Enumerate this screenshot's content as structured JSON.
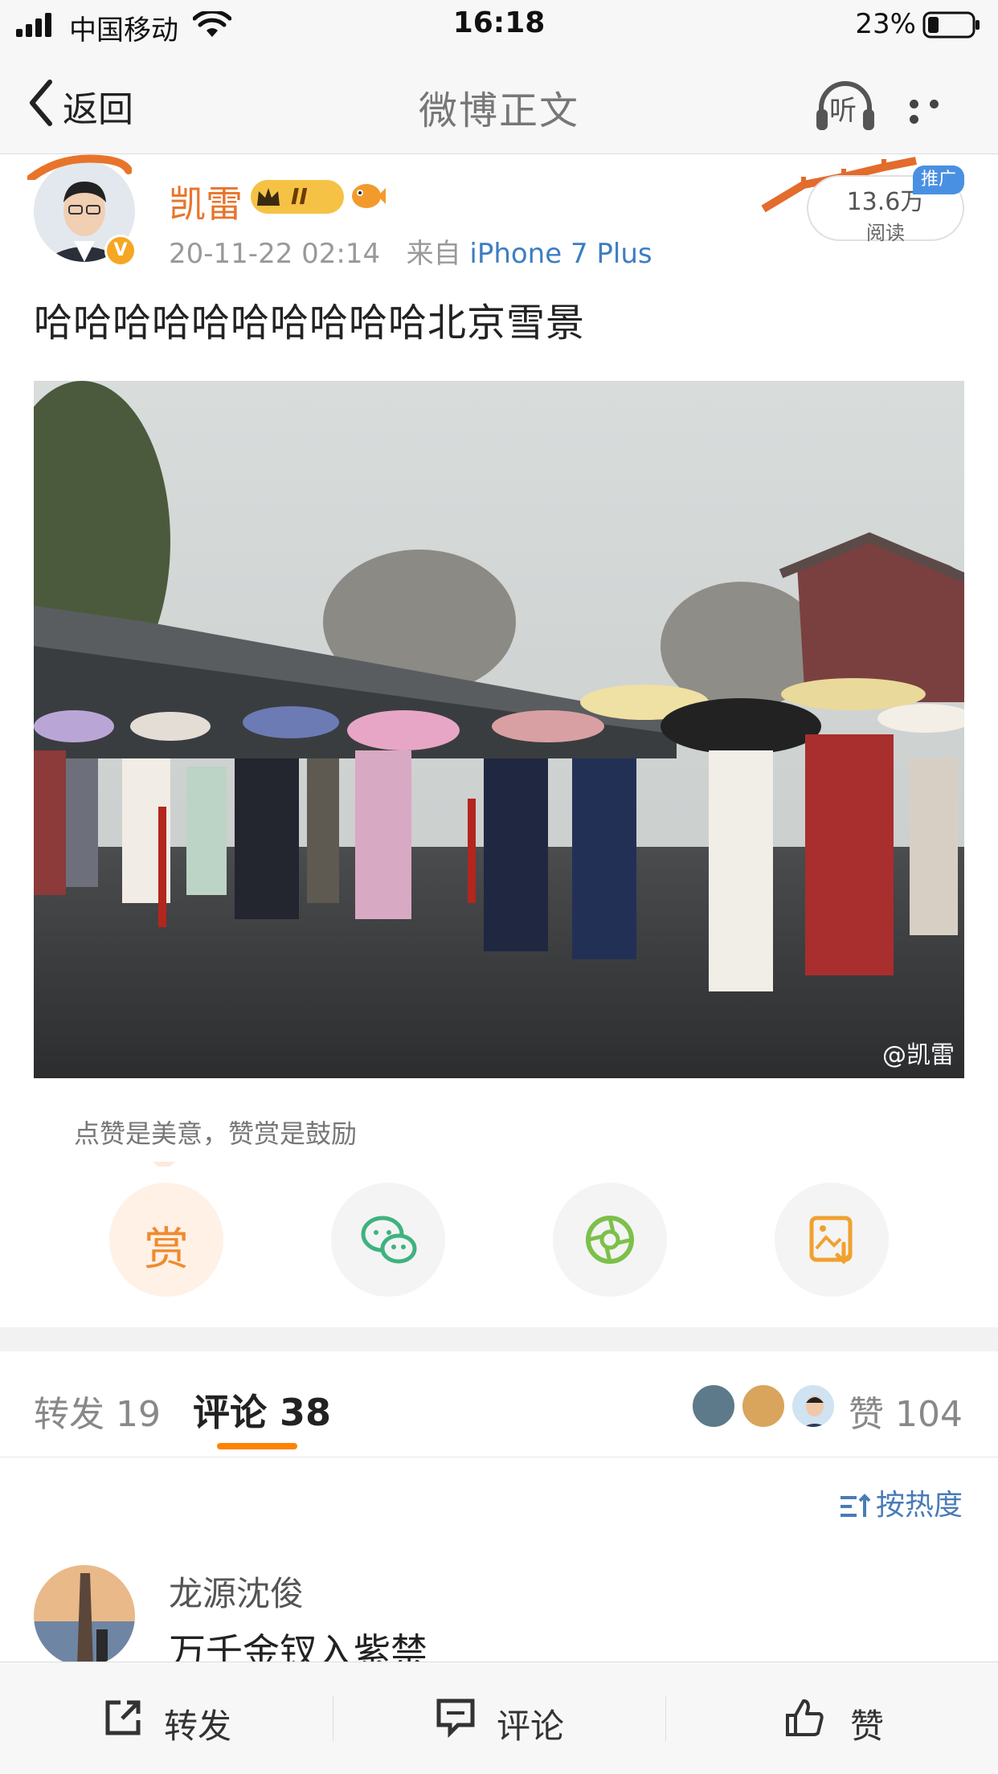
{
  "status_bar": {
    "carrier": "中国移动",
    "time": "16:18",
    "battery": "23%"
  },
  "nav": {
    "back_label": "返回",
    "title": "微博正文",
    "listen_label": "听"
  },
  "post": {
    "author": "凯雷",
    "member_badge": "II",
    "date": "20-11-22 02:14",
    "source_prefix": "来自",
    "source_device": "iPhone 7 Plus",
    "reads_count": "13.6万",
    "reads_label": "阅读",
    "promo_tag": "推广",
    "text": "哈哈哈哈哈哈哈哈哈哈北京雪景",
    "image_watermark": "@凯雷"
  },
  "actions": {
    "tooltip": "点赞是美意，赞赏是鼓励",
    "reward_label": "赏",
    "items": [
      "reward-icon",
      "wechat-icon",
      "moments-icon",
      "save-image-icon"
    ]
  },
  "tabs": {
    "repost_label": "转发 19",
    "comment_label": "评论 38",
    "likes_prefix": "赞",
    "likes_count": "104"
  },
  "sort": {
    "label": "按热度"
  },
  "comments": [
    {
      "name": "龙源沈俊",
      "text": "万千金钗入紫禁"
    }
  ],
  "toolbar": {
    "repost": "转发",
    "comment": "评论",
    "like": "赞"
  },
  "colors": {
    "accent": "#ff8200",
    "author": "#e8742a",
    "link": "#3e7dc2"
  }
}
